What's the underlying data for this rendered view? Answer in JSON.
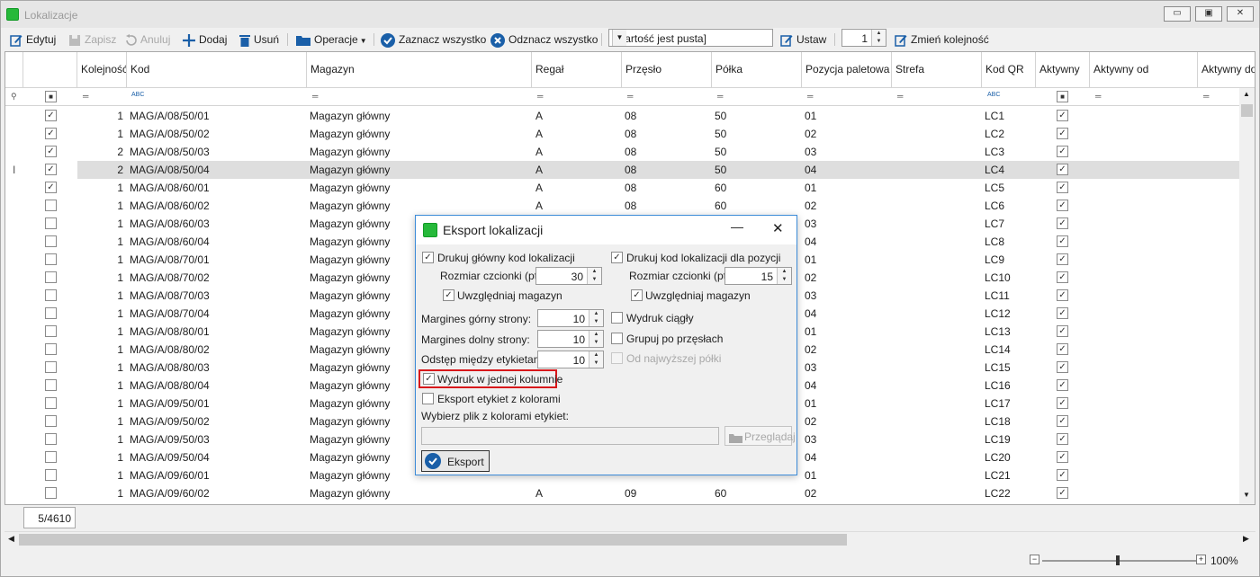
{
  "window": {
    "title": "Lokalizacje",
    "btn_min": "▭",
    "btn_max": "▣",
    "btn_close": "✕"
  },
  "toolbar": {
    "edit": "Edytuj",
    "save": "Zapisz",
    "cancel": "Anuluj",
    "add": "Dodaj",
    "delete": "Usuń",
    "operations": "Operacje",
    "select_all": "Zaznacz wszystko",
    "deselect_all": "Odznacz wszystko",
    "combo_value": "[Wartość jest pusta]",
    "set": "Ustaw",
    "spin_value": "1",
    "change_order": "Zmień kolejność"
  },
  "grid": {
    "columns": [
      "Kolejność",
      "Kod",
      "Magazyn",
      "Regał",
      "Przęsło",
      "Półka",
      "Pozycja paletowa",
      "Strefa",
      "Kod QR",
      "Aktywny",
      "Aktywny od",
      "Aktywny do"
    ],
    "filter_abc": "ABC",
    "row_indicator": "I",
    "rows": [
      {
        "chk": true,
        "order": "1",
        "code": "MAG/A/08/50/01",
        "wh": "Magazyn główny",
        "rack": "A",
        "bay": "08",
        "shelf": "50",
        "pos": "01",
        "qr": "LC1"
      },
      {
        "chk": true,
        "order": "1",
        "code": "MAG/A/08/50/02",
        "wh": "Magazyn główny",
        "rack": "A",
        "bay": "08",
        "shelf": "50",
        "pos": "02",
        "qr": "LC2"
      },
      {
        "chk": true,
        "order": "2",
        "code": "MAG/A/08/50/03",
        "wh": "Magazyn główny",
        "rack": "A",
        "bay": "08",
        "shelf": "50",
        "pos": "03",
        "qr": "LC3"
      },
      {
        "chk": true,
        "order": "2",
        "code": "MAG/A/08/50/04",
        "wh": "Magazyn główny",
        "rack": "A",
        "bay": "08",
        "shelf": "50",
        "pos": "04",
        "qr": "LC4"
      },
      {
        "chk": true,
        "order": "1",
        "code": "MAG/A/08/60/01",
        "wh": "Magazyn główny",
        "rack": "A",
        "bay": "08",
        "shelf": "60",
        "pos": "01",
        "qr": "LC5"
      },
      {
        "chk": false,
        "order": "1",
        "code": "MAG/A/08/60/02",
        "wh": "Magazyn główny",
        "rack": "A",
        "bay": "08",
        "shelf": "60",
        "pos": "02",
        "qr": "LC6"
      },
      {
        "chk": false,
        "order": "1",
        "code": "MAG/A/08/60/03",
        "wh": "Magazyn główny",
        "rack": "",
        "bay": "",
        "shelf": "",
        "pos": "03",
        "qr": "LC7"
      },
      {
        "chk": false,
        "order": "1",
        "code": "MAG/A/08/60/04",
        "wh": "Magazyn główny",
        "rack": "",
        "bay": "",
        "shelf": "",
        "pos": "04",
        "qr": "LC8"
      },
      {
        "chk": false,
        "order": "1",
        "code": "MAG/A/08/70/01",
        "wh": "Magazyn główny",
        "rack": "",
        "bay": "",
        "shelf": "",
        "pos": "01",
        "qr": "LC9"
      },
      {
        "chk": false,
        "order": "1",
        "code": "MAG/A/08/70/02",
        "wh": "Magazyn główny",
        "rack": "",
        "bay": "",
        "shelf": "",
        "pos": "02",
        "qr": "LC10"
      },
      {
        "chk": false,
        "order": "1",
        "code": "MAG/A/08/70/03",
        "wh": "Magazyn główny",
        "rack": "",
        "bay": "",
        "shelf": "",
        "pos": "03",
        "qr": "LC11"
      },
      {
        "chk": false,
        "order": "1",
        "code": "MAG/A/08/70/04",
        "wh": "Magazyn główny",
        "rack": "",
        "bay": "",
        "shelf": "",
        "pos": "04",
        "qr": "LC12"
      },
      {
        "chk": false,
        "order": "1",
        "code": "MAG/A/08/80/01",
        "wh": "Magazyn główny",
        "rack": "",
        "bay": "",
        "shelf": "",
        "pos": "01",
        "qr": "LC13"
      },
      {
        "chk": false,
        "order": "1",
        "code": "MAG/A/08/80/02",
        "wh": "Magazyn główny",
        "rack": "",
        "bay": "",
        "shelf": "",
        "pos": "02",
        "qr": "LC14"
      },
      {
        "chk": false,
        "order": "1",
        "code": "MAG/A/08/80/03",
        "wh": "Magazyn główny",
        "rack": "",
        "bay": "",
        "shelf": "",
        "pos": "03",
        "qr": "LC15"
      },
      {
        "chk": false,
        "order": "1",
        "code": "MAG/A/08/80/04",
        "wh": "Magazyn główny",
        "rack": "",
        "bay": "",
        "shelf": "",
        "pos": "04",
        "qr": "LC16"
      },
      {
        "chk": false,
        "order": "1",
        "code": "MAG/A/09/50/01",
        "wh": "Magazyn główny",
        "rack": "",
        "bay": "",
        "shelf": "",
        "pos": "01",
        "qr": "LC17"
      },
      {
        "chk": false,
        "order": "1",
        "code": "MAG/A/09/50/02",
        "wh": "Magazyn główny",
        "rack": "",
        "bay": "",
        "shelf": "",
        "pos": "02",
        "qr": "LC18"
      },
      {
        "chk": false,
        "order": "1",
        "code": "MAG/A/09/50/03",
        "wh": "Magazyn główny",
        "rack": "",
        "bay": "",
        "shelf": "",
        "pos": "03",
        "qr": "LC19"
      },
      {
        "chk": false,
        "order": "1",
        "code": "MAG/A/09/50/04",
        "wh": "Magazyn główny",
        "rack": "",
        "bay": "",
        "shelf": "",
        "pos": "04",
        "qr": "LC20"
      },
      {
        "chk": false,
        "order": "1",
        "code": "MAG/A/09/60/01",
        "wh": "Magazyn główny",
        "rack": "",
        "bay": "",
        "shelf": "",
        "pos": "01",
        "qr": "LC21"
      },
      {
        "chk": false,
        "order": "1",
        "code": "MAG/A/09/60/02",
        "wh": "Magazyn główny",
        "rack": "A",
        "bay": "09",
        "shelf": "60",
        "pos": "02",
        "qr": "LC22"
      }
    ]
  },
  "status": {
    "count": "5/4610",
    "zoom": "100%",
    "zoom_minus": "−",
    "zoom_plus": "+"
  },
  "dialog": {
    "title": "Eksport lokalizacji",
    "btn_min": "—",
    "btn_close": "✕",
    "print_main": "Drukuj główny kod lokalizacji",
    "print_pos": "Drukuj kod lokalizacji dla pozycji",
    "font_size_label": "Rozmiar czcionki (pt):",
    "font_size_main": "30",
    "font_size_pos": "15",
    "include_wh": "Uwzględniaj magazyn",
    "margin_top_label": "Margines górny strony:",
    "margin_top": "10",
    "margin_bottom_label": "Margines dolny strony:",
    "margin_bottom": "10",
    "gap_label": "Odstęp między etykietami:",
    "gap": "10",
    "continuous": "Wydruk ciągły",
    "group_bay": "Grupuj po przęsłach",
    "from_top": "Od najwyższej półki",
    "single_column": "Wydruk w jednej kolumnie",
    "export_colors": "Eksport etykiet z kolorami",
    "choose_file": "Wybierz plik z kolorami etykiet:",
    "browse": "Przeglądaj",
    "export": "Eksport"
  },
  "colors": {
    "accent": "#1a5fa8",
    "green": "#26b93a",
    "highlight": "#d8181b"
  }
}
